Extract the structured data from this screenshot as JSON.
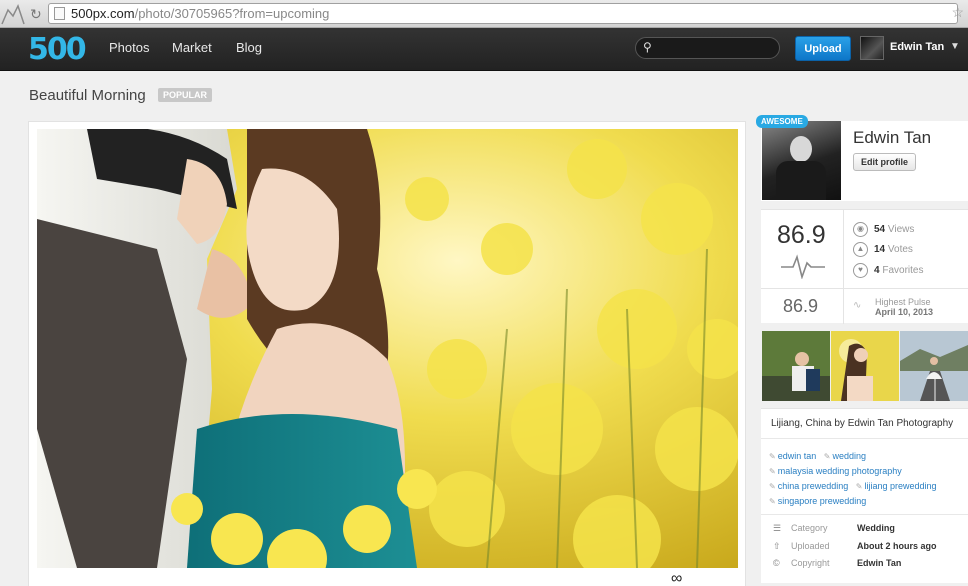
{
  "browser": {
    "url_host": "500px.com",
    "url_path": "/photo/30705965?from=upcoming"
  },
  "header": {
    "brand": "500",
    "nav": [
      "Photos",
      "Market",
      "Blog"
    ],
    "search_placeholder": "",
    "upload_label": "Upload",
    "user_name": "Edwin Tan"
  },
  "photo": {
    "title": "Beautiful Morning",
    "badge": "POPULAR"
  },
  "owner": {
    "badge": "AWESOME",
    "name": "Edwin Tan",
    "edit_label": "Edit profile"
  },
  "stats": {
    "pulse": "86.9",
    "views_count": "54",
    "views_label": "Views",
    "votes_count": "14",
    "votes_label": "Votes",
    "favorites_count": "4",
    "favorites_label": "Favorites",
    "highest_pulse_value": "86.9",
    "highest_pulse_label": "Highest Pulse",
    "highest_pulse_date": "April 10, 2013"
  },
  "description": "Lijiang, China by Edwin Tan Photography",
  "tags": [
    "edwin tan",
    "wedding",
    "malaysia wedding photography",
    "china prewedding",
    "lijiang prewedding",
    "singapore prewedding"
  ],
  "meta": [
    {
      "label": "Category",
      "value": "Wedding",
      "icon": "list-icon"
    },
    {
      "label": "Uploaded",
      "value": "About 2 hours ago",
      "icon": "upload-arrow-icon"
    },
    {
      "label": "Copyright",
      "value": "Edwin Tan",
      "icon": "copyright-icon"
    }
  ],
  "colors": {
    "accent": "#33b7e7",
    "upload": "#1a8fdc",
    "tag_link": "#2a7fc2",
    "header_bg": "#2a2a2a"
  }
}
